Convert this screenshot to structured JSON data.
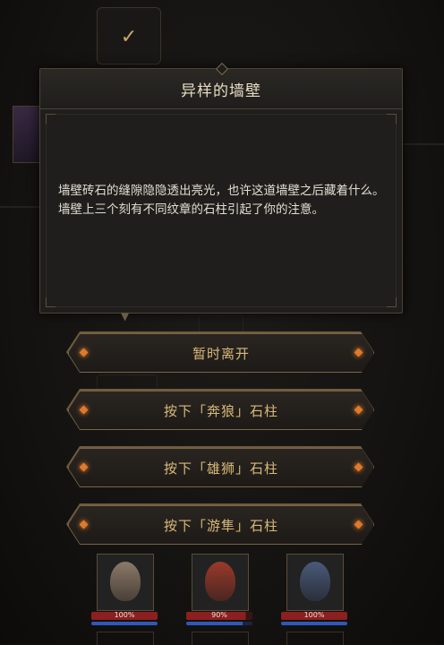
{
  "dialog": {
    "title": "异样的墙壁",
    "lines": [
      "墙壁砖石的缝隙隐隐透出亮光，也许这道墙壁之后藏着什么。",
      "墙壁上三个刻有不同纹章的石柱引起了你的注意。"
    ]
  },
  "options": [
    {
      "label": "暂时离开"
    },
    {
      "label": "按下「奔狼」石柱"
    },
    {
      "label": "按下「雄狮」石柱"
    },
    {
      "label": "按下「游隼」石柱"
    }
  ],
  "party": [
    {
      "hp_label": "100%",
      "hp": 1.0,
      "mp": 1.0
    },
    {
      "hp_label": "90%",
      "hp": 0.9,
      "mp": 0.85
    },
    {
      "hp_label": "100%",
      "hp": 1.0,
      "mp": 1.0
    }
  ],
  "colors": {
    "accent_gold": "#d9b97a",
    "hp_red": "#8c1f1f",
    "mp_blue": "#2f58b8",
    "gem_orange": "#e0792a"
  },
  "icons": {
    "top_card": "checkmark-icon"
  }
}
